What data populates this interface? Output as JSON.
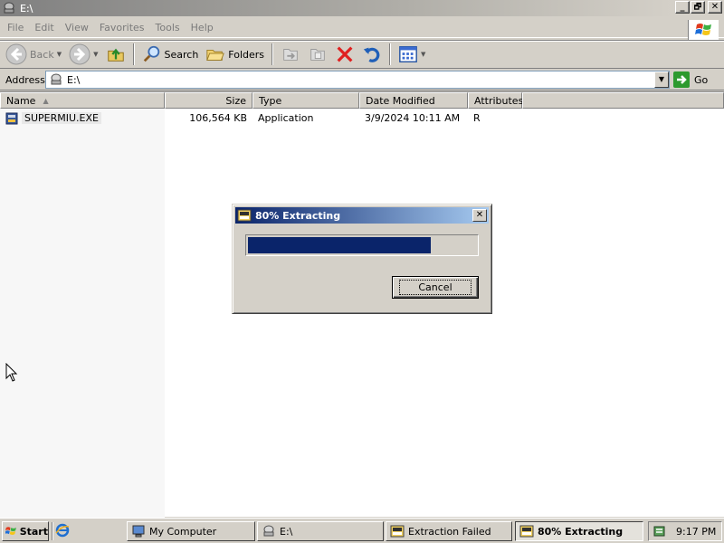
{
  "window": {
    "title": "E:\\",
    "controls": {
      "minimize": "_",
      "restore": "🗗",
      "close": "✕"
    }
  },
  "menu": {
    "items": [
      "File",
      "Edit",
      "View",
      "Favorites",
      "Tools",
      "Help"
    ]
  },
  "toolbar": {
    "back_label": "Back",
    "search_label": "Search",
    "folders_label": "Folders"
  },
  "address": {
    "label": "Address",
    "value": "E:\\",
    "go_label": "Go"
  },
  "filelist": {
    "columns": [
      "Name",
      "Size",
      "Type",
      "Date Modified",
      "Attributes"
    ],
    "rows": [
      {
        "name": "SUPERMIU.EXE",
        "size": "106,564 KB",
        "type": "Application",
        "modified": "3/9/2024 10:11 AM",
        "attributes": "R"
      }
    ]
  },
  "dialog": {
    "title": "80% Extracting",
    "progress_percent": 80,
    "cancel_label": "Cancel"
  },
  "taskbar": {
    "start_label": "Start",
    "tasks": [
      {
        "label": "My Computer"
      },
      {
        "label": "E:\\"
      },
      {
        "label": "Extraction Failed"
      },
      {
        "label": "80% Extracting"
      }
    ],
    "clock": "9:17 PM"
  },
  "colors": {
    "dialog_title_start": "#0a246a",
    "dialog_title_end": "#a6caf0",
    "progress_fill": "#0a246a",
    "window_face": "#d4d0c8"
  }
}
